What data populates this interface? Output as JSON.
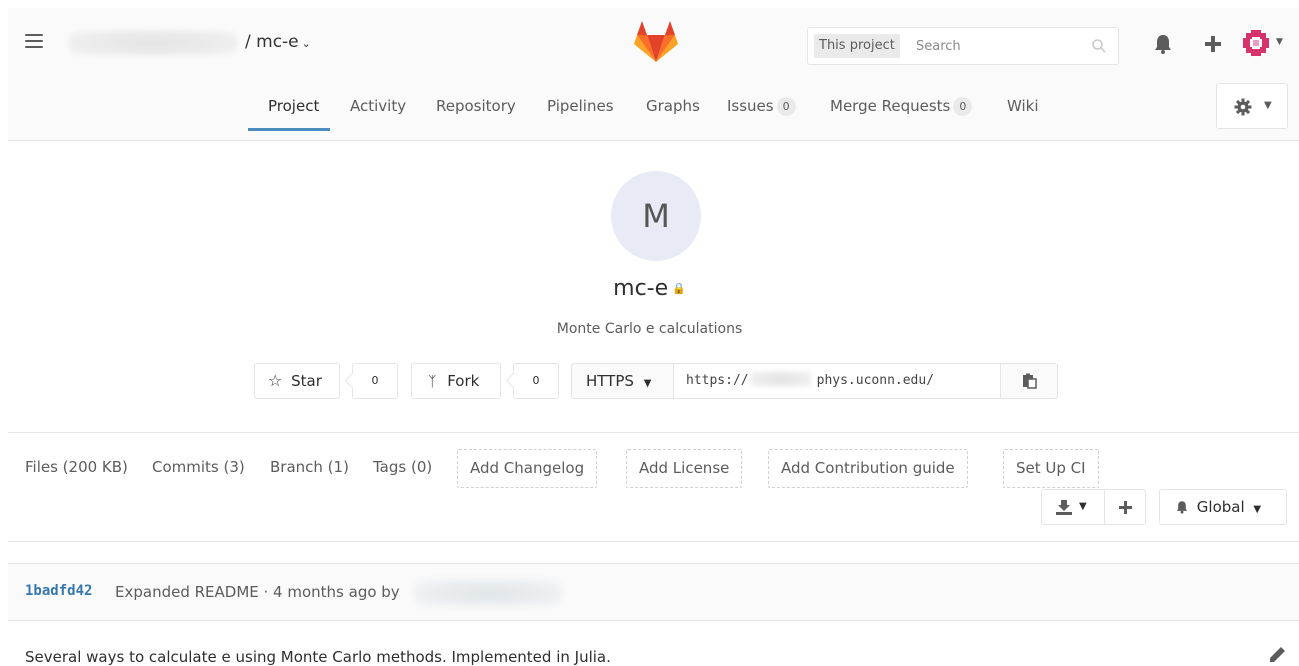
{
  "header": {
    "project_crumb": "/ mc-e",
    "search": {
      "scope": "This project",
      "placeholder": "Search"
    }
  },
  "nav": {
    "tabs": [
      {
        "label": "Project"
      },
      {
        "label": "Activity"
      },
      {
        "label": "Repository"
      },
      {
        "label": "Pipelines"
      },
      {
        "label": "Graphs"
      },
      {
        "label": "Issues",
        "count": "0"
      },
      {
        "label": "Merge Requests",
        "count": "0"
      },
      {
        "label": "Wiki"
      }
    ]
  },
  "project": {
    "avatar_letter": "M",
    "name": "mc-e",
    "description": "Monte Carlo e calculations",
    "star_label": "Star",
    "star_count": "0",
    "fork_label": "Fork",
    "fork_count": "0",
    "clone_protocol": "HTTPS",
    "clone_url_prefix": "https://",
    "clone_url_suffix": "phys.uconn.edu/"
  },
  "stats": {
    "files": "Files (200 KB)",
    "commits": "Commits (3)",
    "branch": "Branch (1)",
    "tags": "Tags (0)",
    "add_changelog": "Add Changelog",
    "add_license": "Add License",
    "add_contribution": "Add Contribution guide",
    "setup_ci": "Set Up CI",
    "notification_level": "Global"
  },
  "last_commit": {
    "sha": "1badfd42",
    "message": "Expanded README · 4 months ago by"
  },
  "readme": {
    "text": "Several ways to calculate e using Monte Carlo methods. Implemented in Julia."
  },
  "colors": {
    "accent": "#4a8bc2",
    "link": "#3777b0",
    "avatar_bg": "#e8eaf6",
    "logo_orange": "#fc6d26",
    "logo_red": "#e24329",
    "logo_light": "#fca326"
  }
}
